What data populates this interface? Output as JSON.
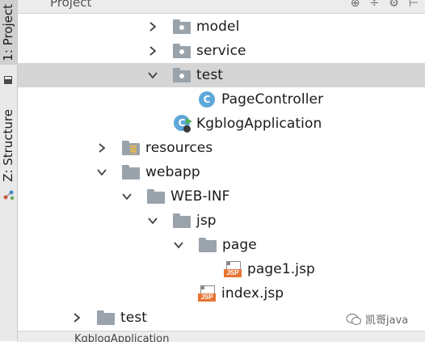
{
  "side_tabs": {
    "project": "1: Project",
    "structure": "Z: Structure"
  },
  "header": {
    "title": "Project"
  },
  "tree": [
    {
      "label": "model",
      "icon": "folder-icon",
      "expanded": false,
      "selected": false
    },
    {
      "label": "service",
      "icon": "folder-icon",
      "expanded": false,
      "selected": false
    },
    {
      "label": "test",
      "icon": "folder-icon",
      "expanded": true,
      "selected": true
    },
    {
      "label": "PageController",
      "icon": "class-icon",
      "expanded": null,
      "selected": false
    },
    {
      "label": "KgblogApplication",
      "icon": "spring-class-icon",
      "expanded": null,
      "selected": false
    },
    {
      "label": "resources",
      "icon": "resources-folder-icon",
      "expanded": false,
      "selected": false
    },
    {
      "label": "webapp",
      "icon": "folder-icon",
      "expanded": true,
      "selected": false
    },
    {
      "label": "WEB-INF",
      "icon": "folder-icon",
      "expanded": true,
      "selected": false
    },
    {
      "label": "jsp",
      "icon": "folder-icon",
      "expanded": true,
      "selected": false
    },
    {
      "label": "page",
      "icon": "folder-icon",
      "expanded": true,
      "selected": false
    },
    {
      "label": "page1.jsp",
      "icon": "jsp-file-icon",
      "expanded": null,
      "selected": false
    },
    {
      "label": "index.jsp",
      "icon": "jsp-file-icon",
      "expanded": null,
      "selected": false
    },
    {
      "label": "test",
      "icon": "folder-icon",
      "expanded": false,
      "selected": false
    }
  ],
  "icons": {
    "class_letter": "C",
    "jsp_tag": "JSP"
  },
  "bottom": {
    "text": "KgblogApplication"
  },
  "watermark": {
    "text": "凯哥java"
  },
  "colors": {
    "selection": "#d5d5d5",
    "folder": "#9aa3ab",
    "class_icon": "#5ea8d8",
    "jsp_tag": "#e67534"
  }
}
